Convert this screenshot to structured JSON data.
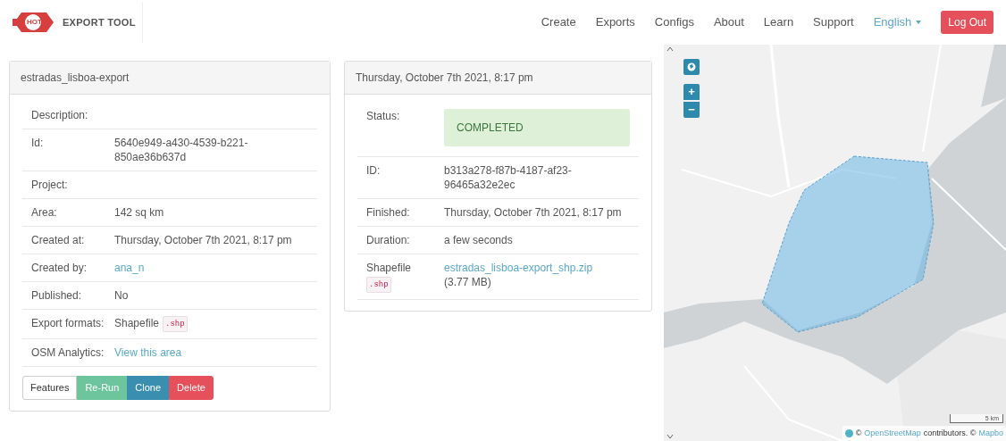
{
  "brand": {
    "logo_text": "HOT",
    "name": "EXPORT TOOL"
  },
  "nav": [
    {
      "label": "Create",
      "kind": "link"
    },
    {
      "label": "Exports",
      "kind": "link"
    },
    {
      "label": "Configs",
      "kind": "link"
    },
    {
      "label": "About",
      "kind": "link"
    },
    {
      "label": "Learn",
      "kind": "link"
    },
    {
      "label": "Support",
      "kind": "link"
    },
    {
      "label": "English",
      "kind": "dropdown"
    },
    {
      "label": "Log Out",
      "kind": "button"
    }
  ],
  "export_panel": {
    "title": "estradas_lisboa-export",
    "rows": [
      {
        "label": "Description:",
        "kind": "text"
      },
      {
        "label": "Id:",
        "kind": "text",
        "value": "5640e949-a430-4539-b221-850ae36b637d"
      },
      {
        "label": "Project:",
        "kind": "text"
      },
      {
        "label": "Area:",
        "kind": "text",
        "value": "142 sq km"
      },
      {
        "label": "Created at:",
        "kind": "text",
        "value": "Thursday, October 7th 2021, 8:17 pm"
      },
      {
        "label": "Created by:",
        "kind": "link",
        "value": "ana_n"
      },
      {
        "label": "Published:",
        "kind": "text",
        "value": "No"
      },
      {
        "label": "Export formats:",
        "kind": "format",
        "value": "Shapefile",
        "code": ".shp"
      },
      {
        "label": "OSM Analytics:",
        "kind": "link",
        "value": "View this area"
      }
    ],
    "buttons": [
      {
        "label": "Features",
        "kind": "default"
      },
      {
        "label": "Re-Run",
        "kind": "success"
      },
      {
        "label": "Clone",
        "kind": "info"
      },
      {
        "label": "Delete",
        "kind": "danger"
      }
    ]
  },
  "run_panel": {
    "title": "Thursday, October 7th 2021, 8:17 pm",
    "rows": [
      {
        "label": "Status:",
        "kind": "status",
        "value": "COMPLETED"
      },
      {
        "label": "ID:",
        "kind": "text",
        "value": "b313a278-f87b-4187-af23-96465a32e2ec"
      },
      {
        "label": "Finished:",
        "kind": "text",
        "value": "Thursday, October 7th 2021, 8:17 pm"
      },
      {
        "label": "Duration:",
        "kind": "text",
        "value": "a few seconds"
      },
      {
        "label": "Shapefile",
        "kind": "file",
        "code": ".shp",
        "value": "estradas_lisboa-export_shp.zip",
        "size": "(3.77 MB)"
      }
    ]
  },
  "map": {
    "kind": "picture",
    "controls": [
      {
        "label": "+",
        "kind": "zoom_in"
      },
      {
        "label": "−",
        "kind": "zoom_out"
      }
    ],
    "scale": "5 km",
    "attribution": {
      "prefix": "©",
      "osm_link": "OpenStreetMap",
      "middle": "contributors. ©",
      "mapbox_link": "Mapbo"
    }
  }
}
